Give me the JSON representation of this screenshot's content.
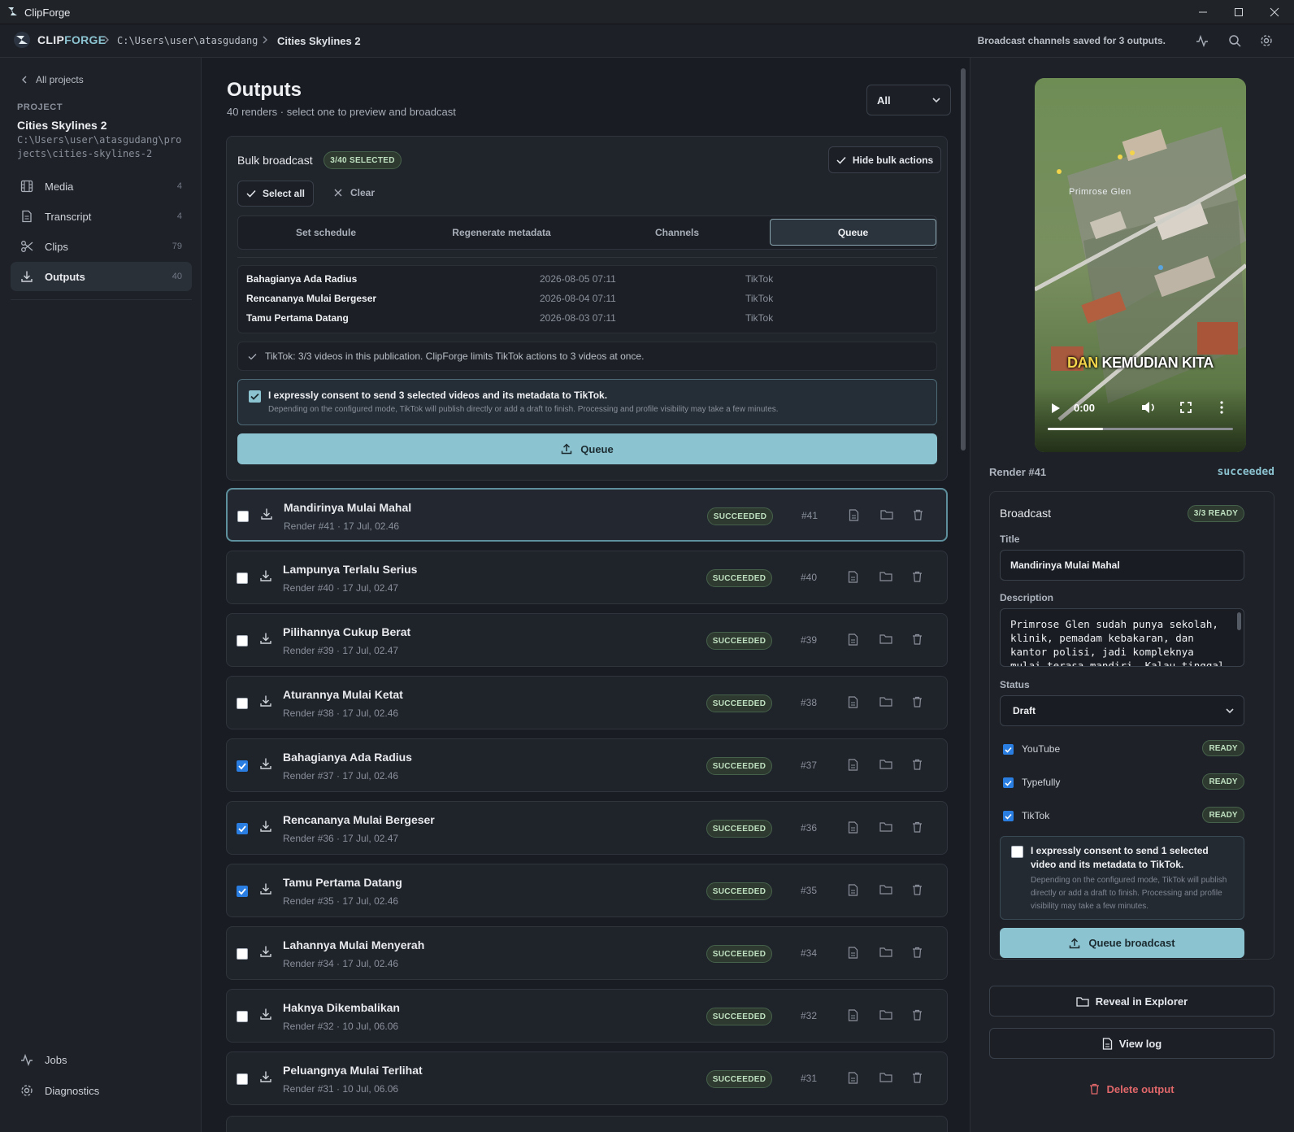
{
  "window": {
    "title": "ClipForge"
  },
  "header": {
    "brand_a": "CLIP",
    "brand_b": "FORGE",
    "path": "C:\\Users\\user\\atasgudang",
    "project": "Cities Skylines 2",
    "status": "Broadcast channels saved for 3 outputs."
  },
  "sidebar": {
    "back": "All projects",
    "project_label": "PROJECT",
    "project_name": "Cities Skylines 2",
    "project_path": "C:\\Users\\user\\atasgudang\\projects\\cities-skylines-2",
    "items": [
      {
        "label": "Media",
        "count": "4"
      },
      {
        "label": "Transcript",
        "count": "4"
      },
      {
        "label": "Clips",
        "count": "79"
      },
      {
        "label": "Outputs",
        "count": "40"
      }
    ],
    "jobs": "Jobs",
    "diagnostics": "Diagnostics"
  },
  "main": {
    "title": "Outputs",
    "subtitle": "40 renders · select one to preview and broadcast",
    "filter": "All",
    "bulk": {
      "title": "Bulk broadcast",
      "selected": "3/40 SELECTED",
      "hide": "Hide bulk actions",
      "select_all": "Select all",
      "clear": "Clear",
      "tabs": [
        "Set schedule",
        "Regenerate metadata",
        "Channels",
        "Queue"
      ],
      "queue": [
        {
          "title": "Bahagianya Ada Radius",
          "date": "2026-08-05 07:11",
          "channel": "TikTok"
        },
        {
          "title": "Rencananya Mulai Bergeser",
          "date": "2026-08-04 07:11",
          "channel": "TikTok"
        },
        {
          "title": "Tamu Pertama Datang",
          "date": "2026-08-03 07:11",
          "channel": "TikTok"
        }
      ],
      "notice": "TikTok: 3/3 videos in this publication. ClipForge limits TikTok actions to 3 videos at once.",
      "consent": "I expressly consent to send 3 selected videos and its metadata to TikTok.",
      "consent_sub": "Depending on the configured mode, TikTok will publish directly or add a draft to finish. Processing and profile visibility may take a few minutes.",
      "queue_btn": "Queue"
    },
    "rows": [
      {
        "title": "Mandirinya Mulai Mahal",
        "meta": "Render #41 · 17 Jul, 02.46",
        "status": "SUCCEEDED",
        "num": "#41",
        "checked": false,
        "selected": true
      },
      {
        "title": "Lampunya Terlalu Serius",
        "meta": "Render #40 · 17 Jul, 02.47",
        "status": "SUCCEEDED",
        "num": "#40",
        "checked": false
      },
      {
        "title": "Pilihannya Cukup Berat",
        "meta": "Render #39 · 17 Jul, 02.47",
        "status": "SUCCEEDED",
        "num": "#39",
        "checked": false
      },
      {
        "title": "Aturannya Mulai Ketat",
        "meta": "Render #38 · 17 Jul, 02.46",
        "status": "SUCCEEDED",
        "num": "#38",
        "checked": false
      },
      {
        "title": "Bahagianya Ada Radius",
        "meta": "Render #37 · 17 Jul, 02.46",
        "status": "SUCCEEDED",
        "num": "#37",
        "checked": true
      },
      {
        "title": "Rencananya Mulai Bergeser",
        "meta": "Render #36 · 17 Jul, 02.47",
        "status": "SUCCEEDED",
        "num": "#36",
        "checked": true
      },
      {
        "title": "Tamu Pertama Datang",
        "meta": "Render #35 · 17 Jul, 02.46",
        "status": "SUCCEEDED",
        "num": "#35",
        "checked": true
      },
      {
        "title": "Lahannya Mulai Menyerah",
        "meta": "Render #34 · 17 Jul, 02.46",
        "status": "SUCCEEDED",
        "num": "#34",
        "checked": false
      },
      {
        "title": "Haknya Dikembalikan",
        "meta": "Render #32 · 10 Jul, 06.06",
        "status": "SUCCEEDED",
        "num": "#32",
        "checked": false
      },
      {
        "title": "Peluangnya Mulai Terlihat",
        "meta": "Render #31 · 10 Jul, 06.06",
        "status": "SUCCEEDED",
        "num": "#31",
        "checked": false
      }
    ]
  },
  "preview": {
    "district": "Primrose Glen",
    "caption_a": "DAN",
    "caption_b": "KEMUDIAN KITA",
    "time": "0:00",
    "progress": 0.3,
    "render": "Render #41",
    "state": "succeeded"
  },
  "broadcast": {
    "title": "Broadcast",
    "ready": "3/3 READY",
    "title_label": "Title",
    "title_value": "Mandirinya Mulai Mahal",
    "desc_label": "Description",
    "desc_value": "Primrose Glen sudah punya sekolah, klinik, pemadam kebakaran, dan kantor polisi, jadi kompleknya mulai terasa mandiri. Kalau tinggal di sini nggak",
    "status_label": "Status",
    "status_value": "Draft",
    "channels": [
      {
        "name": "YouTube",
        "badge": "READY"
      },
      {
        "name": "Typefully",
        "badge": "READY"
      },
      {
        "name": "TikTok",
        "badge": "READY"
      }
    ],
    "consent": "I expressly consent to send 1 selected video and its metadata to TikTok.",
    "consent_sub": "Depending on the configured mode, TikTok will publish directly or add a draft to finish. Processing and profile visibility may take a few minutes.",
    "queue_btn": "Queue broadcast",
    "reveal": "Reveal in Explorer",
    "log": "View log",
    "delete": "Delete output"
  }
}
